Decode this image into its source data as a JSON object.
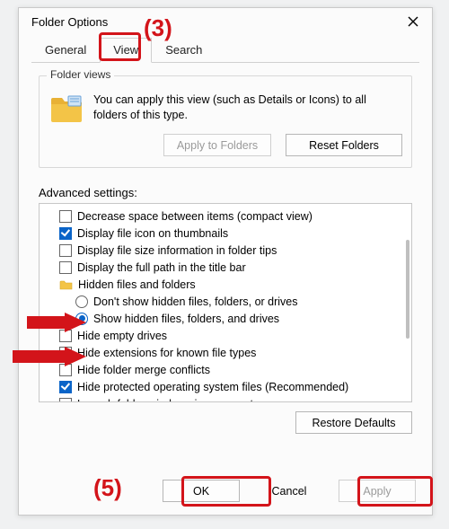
{
  "annotations": {
    "step3": "(3)",
    "step5": "(5)"
  },
  "window": {
    "title": "Folder Options",
    "tabs": {
      "general": "General",
      "view": "View",
      "search": "Search",
      "active": "view"
    }
  },
  "folderViews": {
    "legend": "Folder views",
    "text": "You can apply this view (such as Details or Icons) to all folders of this type.",
    "applyBtn": "Apply to Folders",
    "resetBtn": "Reset Folders"
  },
  "advanced": {
    "label": "Advanced settings:",
    "items": [
      {
        "kind": "check",
        "checked": false,
        "label": "Decrease space between items (compact view)"
      },
      {
        "kind": "check",
        "checked": true,
        "label": "Display file icon on thumbnails"
      },
      {
        "kind": "check",
        "checked": false,
        "label": "Display file size information in folder tips"
      },
      {
        "kind": "check",
        "checked": false,
        "label": "Display the full path in the title bar"
      },
      {
        "kind": "folder",
        "label": "Hidden files and folders"
      },
      {
        "kind": "radio",
        "checked": false,
        "indent": 2,
        "label": "Don't show hidden files, folders, or drives"
      },
      {
        "kind": "radio",
        "checked": true,
        "indent": 2,
        "label": "Show hidden files, folders, and drives"
      },
      {
        "kind": "check",
        "checked": false,
        "label": "Hide empty drives"
      },
      {
        "kind": "check",
        "checked": false,
        "label": "Hide extensions for known file types"
      },
      {
        "kind": "check",
        "checked": false,
        "label": "Hide folder merge conflicts"
      },
      {
        "kind": "check",
        "checked": true,
        "label": "Hide protected operating system files (Recommended)"
      },
      {
        "kind": "check",
        "checked": false,
        "label": "Launch folder windows in a separate process"
      }
    ]
  },
  "buttons": {
    "restore": "Restore Defaults",
    "ok": "OK",
    "cancel": "Cancel",
    "apply": "Apply"
  },
  "colors": {
    "accent": "#0a64c8",
    "annotation": "#d3141a"
  }
}
